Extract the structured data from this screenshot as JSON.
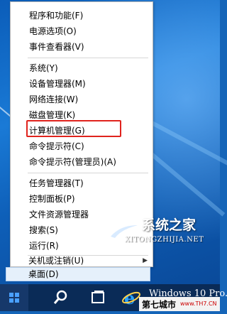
{
  "context_menu": {
    "groups": [
      [
        "程序和功能(F)",
        "电源选项(O)",
        "事件查看器(V)"
      ],
      [
        "系统(Y)",
        "设备管理器(M)",
        "网络连接(W)",
        "磁盘管理(K)",
        "计算机管理(G)",
        "命令提示符(C)",
        "命令提示符(管理员)(A)"
      ],
      [
        "任务管理器(T)",
        "控制面板(P)",
        "文件资源管理器",
        "搜索(S)",
        "运行(R)"
      ],
      [
        "关机或注销(U)",
        "桌面(D)"
      ]
    ],
    "highlighted_item": "计算机管理(G)",
    "hovered_item": "桌面(D)",
    "highlight_color": "#e0231d"
  },
  "watermark": {
    "title": "系统之家",
    "url": "XITONGZHIJIA.NET"
  },
  "taskbar": {
    "start_icon": "windows-logo-icon",
    "search_icon": "search-icon",
    "task_view_icon": "task-view-icon",
    "browser_icon": "internet-explorer-icon",
    "window_label": "Windows 10 Pro.",
    "watermark_strip_text": "第七城市",
    "watermark_strip_url": "www.TH7.CN"
  }
}
